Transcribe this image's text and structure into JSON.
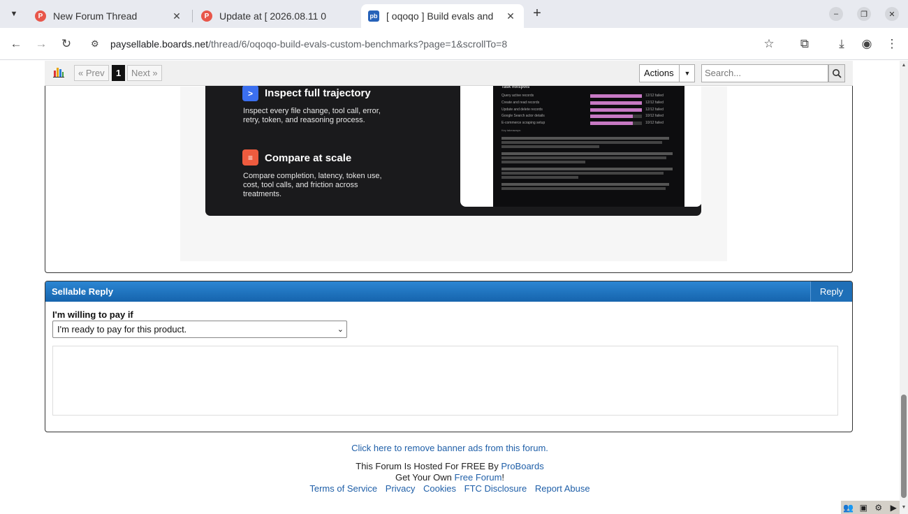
{
  "tabs": [
    {
      "title": "New Forum Thread",
      "favicon": "P"
    },
    {
      "title": "Update at [ 2026.08.11 0",
      "favicon": "P"
    },
    {
      "title": "[ oqoqo ] Build evals and",
      "favicon": "pb"
    }
  ],
  "address": {
    "host": "paysellable.boards.net",
    "path": "/thread/6/oqoqo-build-evals-custom-benchmarks?page=1&scrollTo=8"
  },
  "pager": {
    "prev": "« Prev",
    "current": "1",
    "next": "Next »"
  },
  "actions_label": "Actions",
  "search_placeholder": "Search...",
  "embed": {
    "feature1_title": "Inspect full trajectory",
    "feature1_desc": "Inspect every file change, tool call, error, retry, token, and reasoning process.",
    "feature2_title": "Compare at scale",
    "feature2_desc": "Compare completion, latency, token use, cost, tool calls, and friction across treatments.",
    "screenshot": {
      "heading": "Task hotspots",
      "rows": [
        {
          "label": "Query active records",
          "value": "12/12 failed",
          "level": 1.0
        },
        {
          "label": "Create and read records",
          "value": "12/12 failed",
          "level": 1.0
        },
        {
          "label": "Update and delete records",
          "value": "12/12 failed",
          "level": 1.0
        },
        {
          "label": "Google Search actor details",
          "value": "10/12 failed",
          "level": 0.83
        },
        {
          "label": "E-commerce scraping setup",
          "value": "10/12 failed",
          "level": 0.83
        }
      ],
      "takeaways_heading": "Key takeaways:"
    }
  },
  "reply": {
    "header": "Sellable Reply",
    "reply_button": "Reply",
    "pay_label": "I'm willing to pay if",
    "pay_selected": "I'm ready to pay for this product."
  },
  "footer": {
    "remove_ads": "Click here to remove banner ads from this forum.",
    "hosted_prefix": "This Forum Is Hosted For FREE By ",
    "hosted_link": "ProBoards",
    "own_prefix": "Get Your Own ",
    "own_link": "Free Forum",
    "own_suffix": "!",
    "links": [
      "Terms of Service",
      "Privacy",
      "Cookies",
      "FTC Disclosure",
      "Report Abuse"
    ]
  }
}
